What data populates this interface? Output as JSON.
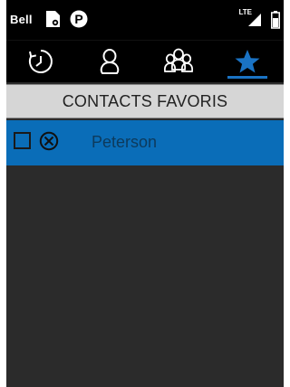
{
  "status_bar": {
    "carrier": "Bell",
    "network_type": "LTE",
    "icons": [
      "sim-card-icon",
      "parking-icon",
      "signal-icon",
      "battery-icon"
    ]
  },
  "tabs": [
    {
      "name": "recent-calls-icon",
      "active": false
    },
    {
      "name": "contact-icon",
      "active": false
    },
    {
      "name": "groups-icon",
      "active": false
    },
    {
      "name": "star-icon",
      "active": true
    }
  ],
  "section": {
    "title": "CONTACTS FAVORIS"
  },
  "favorites": [
    {
      "name": "Peterson",
      "checked": false
    }
  ],
  "colors": {
    "accent": "#1a73c4",
    "selected_row": "#0a6db8",
    "background": "#2b2b2b",
    "header_bg": "#d6d6d6"
  }
}
